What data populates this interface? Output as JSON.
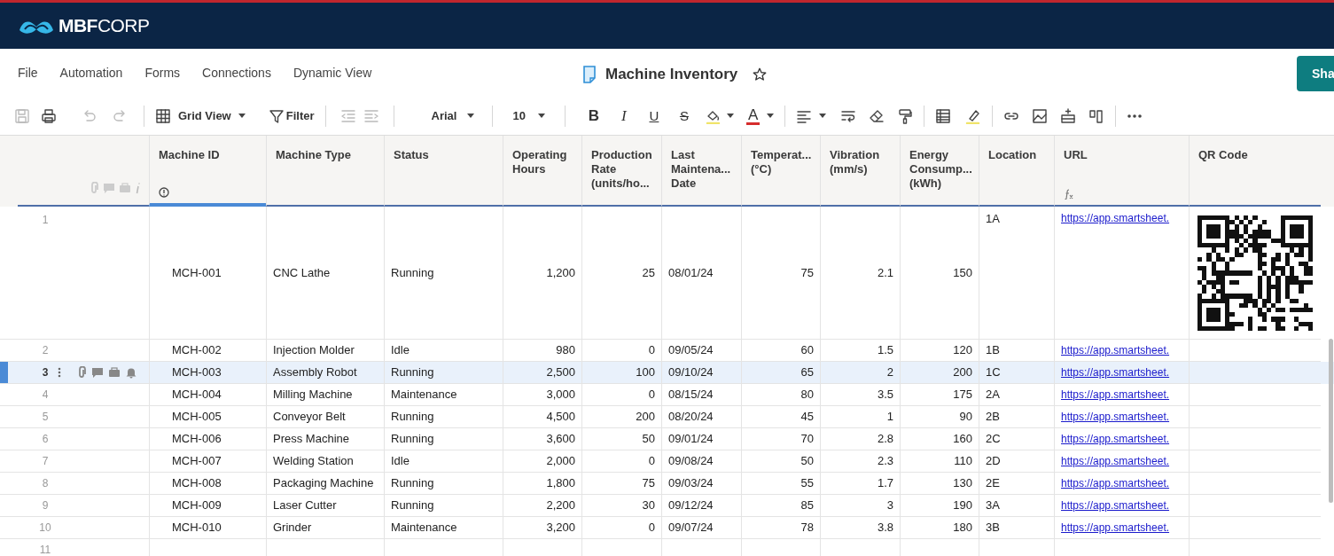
{
  "brand": {
    "bold": "MBF",
    "light": "CORP"
  },
  "menu": [
    "File",
    "Automation",
    "Forms",
    "Connections",
    "Dynamic View"
  ],
  "sheet_title": "Machine Inventory",
  "share_button": "Sha",
  "toolbar": {
    "view": "Grid View",
    "filter": "Filter",
    "font": "Arial",
    "size": "10",
    "format_buttons": [
      "B",
      "I",
      "U",
      "S"
    ],
    "text_color": "A"
  },
  "columns": [
    {
      "label": "Machine ID",
      "kind": "primary"
    },
    {
      "label": "Machine Type",
      "kind": "text"
    },
    {
      "label": "Status",
      "kind": "text"
    },
    {
      "label": "Operating\nHours",
      "kind": "number"
    },
    {
      "label": "Production\nRate\n(units/ho...",
      "kind": "number"
    },
    {
      "label": "Last\nMaintena...\nDate",
      "kind": "text"
    },
    {
      "label": "Temperat...\n(°C)",
      "kind": "number"
    },
    {
      "label": "Vibration\n(mm/s)",
      "kind": "number"
    },
    {
      "label": "Energy\nConsump...\n(kWh)",
      "kind": "number"
    },
    {
      "label": "Location",
      "kind": "location"
    },
    {
      "label": "URL",
      "kind": "formula"
    },
    {
      "label": "QR Code",
      "kind": "image"
    }
  ],
  "rows": [
    {
      "number": "1",
      "selected": false,
      "qr_code": true,
      "cells": [
        "MCH-001",
        "CNC Lathe",
        "Running",
        "1,200",
        "25",
        "08/01/24",
        "75",
        "2.1",
        "150",
        "1A",
        "https://app.smartsheet."
      ]
    },
    {
      "number": "2",
      "selected": false,
      "qr_code": false,
      "cells": [
        "MCH-002",
        "Injection Molder",
        "Idle",
        "980",
        "0",
        "09/05/24",
        "60",
        "1.5",
        "120",
        "1B",
        "https://app.smartsheet."
      ]
    },
    {
      "number": "3",
      "selected": true,
      "qr_code": false,
      "cells": [
        "MCH-003",
        "Assembly Robot",
        "Running",
        "2,500",
        "100",
        "09/10/24",
        "65",
        "2",
        "200",
        "1C",
        "https://app.smartsheet."
      ]
    },
    {
      "number": "4",
      "selected": false,
      "qr_code": false,
      "cells": [
        "MCH-004",
        "Milling Machine",
        "Maintenance",
        "3,000",
        "0",
        "08/15/24",
        "80",
        "3.5",
        "175",
        "2A",
        "https://app.smartsheet."
      ]
    },
    {
      "number": "5",
      "selected": false,
      "qr_code": false,
      "cells": [
        "MCH-005",
        "Conveyor Belt",
        "Running",
        "4,500",
        "200",
        "08/20/24",
        "45",
        "1",
        "90",
        "2B",
        "https://app.smartsheet."
      ]
    },
    {
      "number": "6",
      "selected": false,
      "qr_code": false,
      "cells": [
        "MCH-006",
        "Press Machine",
        "Running",
        "3,600",
        "50",
        "09/01/24",
        "70",
        "2.8",
        "160",
        "2C",
        "https://app.smartsheet."
      ]
    },
    {
      "number": "7",
      "selected": false,
      "qr_code": false,
      "cells": [
        "MCH-007",
        "Welding Station",
        "Idle",
        "2,000",
        "0",
        "09/08/24",
        "50",
        "2.3",
        "110",
        "2D",
        "https://app.smartsheet."
      ]
    },
    {
      "number": "8",
      "selected": false,
      "qr_code": false,
      "cells": [
        "MCH-008",
        "Packaging Machine",
        "Running",
        "1,800",
        "75",
        "09/03/24",
        "55",
        "1.7",
        "130",
        "2E",
        "https://app.smartsheet."
      ]
    },
    {
      "number": "9",
      "selected": false,
      "qr_code": false,
      "cells": [
        "MCH-009",
        "Laser Cutter",
        "Running",
        "2,200",
        "30",
        "09/12/24",
        "85",
        "3",
        "190",
        "3A",
        "https://app.smartsheet."
      ]
    },
    {
      "number": "10",
      "selected": false,
      "qr_code": false,
      "cells": [
        "MCH-010",
        "Grinder",
        "Maintenance",
        "3,200",
        "0",
        "09/07/24",
        "78",
        "3.8",
        "180",
        "3B",
        "https://app.smartsheet."
      ]
    },
    {
      "number": "11",
      "selected": false,
      "qr_code": false,
      "cells": []
    }
  ]
}
